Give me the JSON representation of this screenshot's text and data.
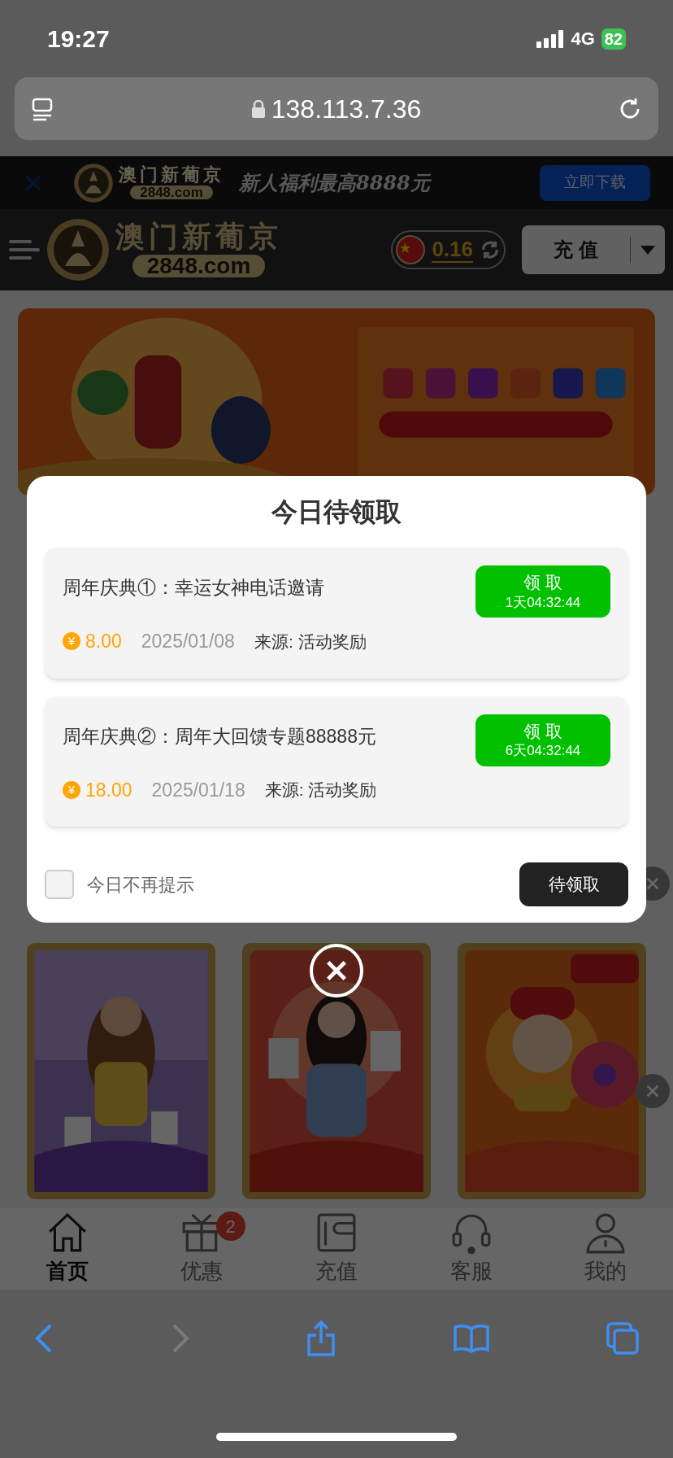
{
  "status_bar": {
    "time": "19:27",
    "network": "4G",
    "battery": "82"
  },
  "address_bar": {
    "url": "138.113.7.36"
  },
  "download_bar": {
    "brand": "澳门新葡京",
    "domain": "2848.com",
    "slogan": "新人福利最高8888元",
    "button": "立即下载"
  },
  "header": {
    "brand": "澳门新葡京",
    "domain": "2848.com",
    "balance": "0.16",
    "recharge": "充 值"
  },
  "modal": {
    "title": "今日待领取",
    "items": [
      {
        "title": "周年庆典①：幸运女神电话邀请",
        "currency": "¥",
        "amount": "8.00",
        "date": "2025/01/08",
        "source": "来源: 活动奖励",
        "button": "领 取",
        "countdown": "1天04:32:44"
      },
      {
        "title": "周年庆典②：周年大回馈专题88888元",
        "currency": "¥",
        "amount": "18.00",
        "date": "2025/01/18",
        "source": "来源: 活动奖励",
        "button": "领 取",
        "countdown": "6天04:32:44"
      }
    ],
    "dont_remind": {
      "label": "今日不再提示",
      "checked": false
    },
    "button": "待领取"
  },
  "bottom_nav": [
    {
      "label": "首页",
      "kind": "home",
      "selected": true
    },
    {
      "label": "优惠",
      "kind": "gift",
      "selected": false,
      "badge": "2"
    },
    {
      "label": "充值",
      "kind": "wallet",
      "selected": false
    },
    {
      "label": "客服",
      "kind": "headset",
      "selected": false
    },
    {
      "label": "我的",
      "kind": "user",
      "selected": false
    }
  ],
  "browser_toolbar": {
    "back_disabled": false,
    "forward_disabled": true
  }
}
